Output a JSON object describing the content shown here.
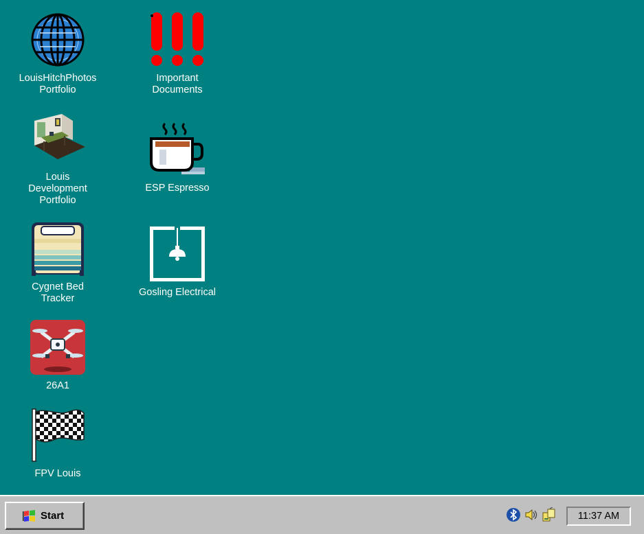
{
  "desktop": {
    "background_color": "#008080",
    "icons": [
      {
        "label": "LouisHitchPhotos\nPortfolio",
        "icon": "globe-icon"
      },
      {
        "label": "Louis\nDevelopment\nPortfolio",
        "icon": "room-icon"
      },
      {
        "label": "Cygnet Bed\nTracker",
        "icon": "bed-icon"
      },
      {
        "label": "26A1",
        "icon": "drone-icon"
      },
      {
        "label": "FPV Louis",
        "icon": "checkered-flag-icon"
      },
      {
        "label": "Important\nDocuments",
        "icon": "exclamation-marks-icon"
      },
      {
        "label": "ESP Espresso",
        "icon": "coffee-cup-icon"
      },
      {
        "label": "Gosling Electrical",
        "icon": "lightbulb-icon"
      }
    ]
  },
  "taskbar": {
    "start_label": "Start",
    "tray_icons": [
      "bluetooth-icon",
      "volume-icon",
      "network-icon"
    ],
    "clock": "11:37 AM"
  }
}
